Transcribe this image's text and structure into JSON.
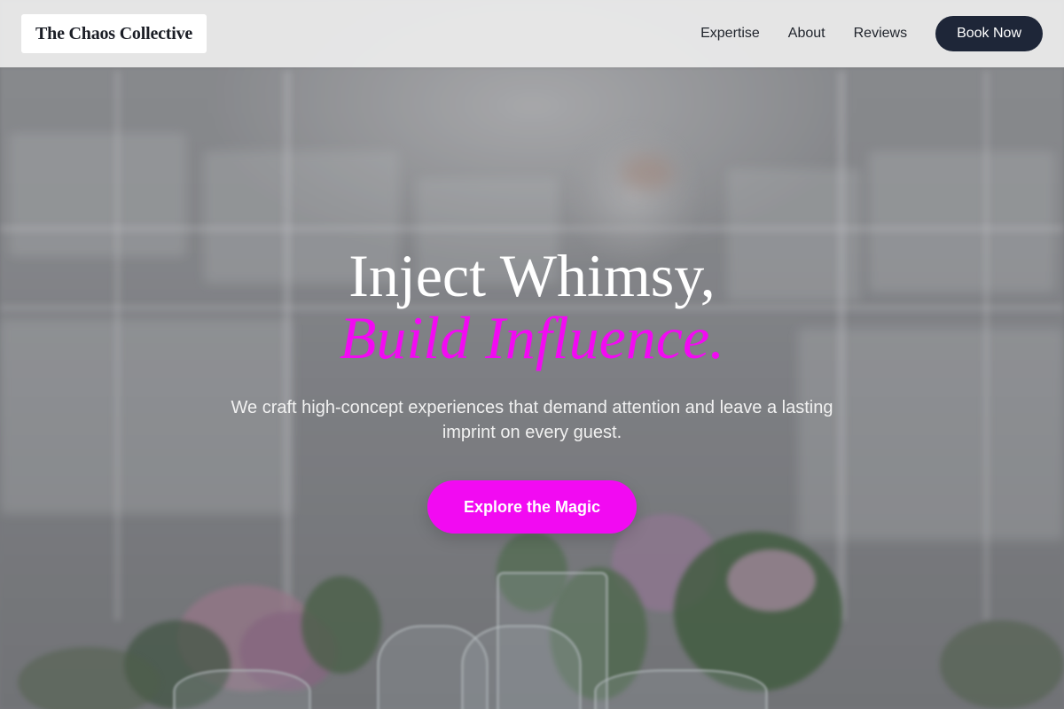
{
  "brand": {
    "name": "The Chaos Collective"
  },
  "nav": {
    "links": [
      {
        "label": "Expertise"
      },
      {
        "label": "About"
      },
      {
        "label": "Reviews"
      }
    ],
    "cta_label": "Book Now"
  },
  "hero": {
    "title_line1": "Inject Whimsy,",
    "title_line2": "Build Influence.",
    "subtitle": "We craft high-concept experiences that demand attention and leave a lasting imprint on every guest.",
    "cta_label": "Explore the Magic"
  },
  "colors": {
    "accent": "#f20af2",
    "dark": "#1e2638",
    "header_bg": "#ececec"
  }
}
